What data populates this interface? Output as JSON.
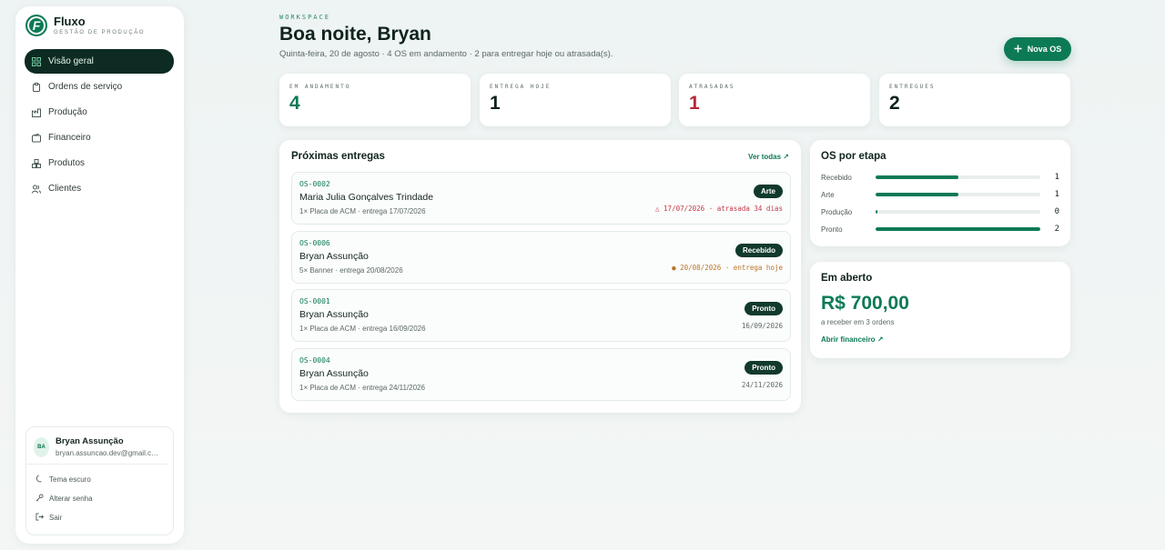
{
  "app": {
    "name": "Fluxo",
    "subtitle": "GESTÃO DE PRODUÇÃO"
  },
  "sidebar": {
    "items": [
      {
        "label": "Visão geral",
        "icon": "grid-icon",
        "active": true
      },
      {
        "label": "Ordens de serviço",
        "icon": "clipboard-icon"
      },
      {
        "label": "Produção",
        "icon": "factory-icon"
      },
      {
        "label": "Financeiro",
        "icon": "wallet-icon"
      },
      {
        "label": "Produtos",
        "icon": "boxes-icon"
      },
      {
        "label": "Clientes",
        "icon": "users-icon"
      }
    ]
  },
  "user": {
    "initials": "BA",
    "name": "Bryan Assunção",
    "email": "bryan.assuncao.dev@gmail.com",
    "actions": [
      {
        "label": "Tema escuro",
        "icon": "moon-icon"
      },
      {
        "label": "Alterar senha",
        "icon": "key-icon"
      },
      {
        "label": "Sair",
        "icon": "logout-icon"
      }
    ]
  },
  "header": {
    "eyebrow": "WORKSPACE",
    "greeting": "Boa noite, Bryan",
    "subline": "Quinta-feira, 20 de agosto · 4 OS em andamento · 2 para entregar hoje ou atrasada(s).",
    "new_button": "Nova OS"
  },
  "stats": [
    {
      "label": "EM ANDAMENTO",
      "value": "4",
      "color": "#0c7a55"
    },
    {
      "label": "ENTREGA HOJE",
      "value": "1",
      "color": "#0f231c"
    },
    {
      "label": "ATRASADAS",
      "value": "1",
      "color": "#b8283a"
    },
    {
      "label": "ENTREGUES",
      "value": "2",
      "color": "#0f231c"
    }
  ],
  "deliveries": {
    "title": "Próximas entregas",
    "see_all": "Ver todas",
    "orders": [
      {
        "id": "OS-0002",
        "client": "Maria Julia Gonçalves Trindade",
        "meta": "1× Placa de ACM · entrega 17/07/2026",
        "status": "Arte",
        "date": "17/07/2026 · atrasada 34 dias"
      },
      {
        "id": "OS-0006",
        "client": "Bryan Assunção",
        "meta": "5× Banner · entrega 20/08/2026",
        "status": "Recebido",
        "date": "20/08/2026 · entrega hoje"
      },
      {
        "id": "OS-0001",
        "client": "Bryan Assunção",
        "meta": "1× Placa de ACM · entrega 16/09/2026",
        "status": "Pronto",
        "date": "16/09/2026"
      },
      {
        "id": "OS-0004",
        "client": "Bryan Assunção",
        "meta": "1× Placa de ACM · entrega 24/11/2026",
        "status": "Pronto",
        "date": "24/11/2026"
      }
    ]
  },
  "stages": {
    "title": "OS por etapa",
    "rows": [
      {
        "label": "Recebido",
        "count": "1",
        "fill": 0.5
      },
      {
        "label": "Arte",
        "count": "1",
        "fill": 0.5
      },
      {
        "label": "Produção",
        "count": "0",
        "fill": 0.01
      },
      {
        "label": "Pronto",
        "count": "2",
        "fill": 1.0
      }
    ]
  },
  "open": {
    "title": "Em aberto",
    "amount": "R$ 700,00",
    "sub": "a receber em 3 ordens",
    "link": "Abrir financeiro"
  }
}
